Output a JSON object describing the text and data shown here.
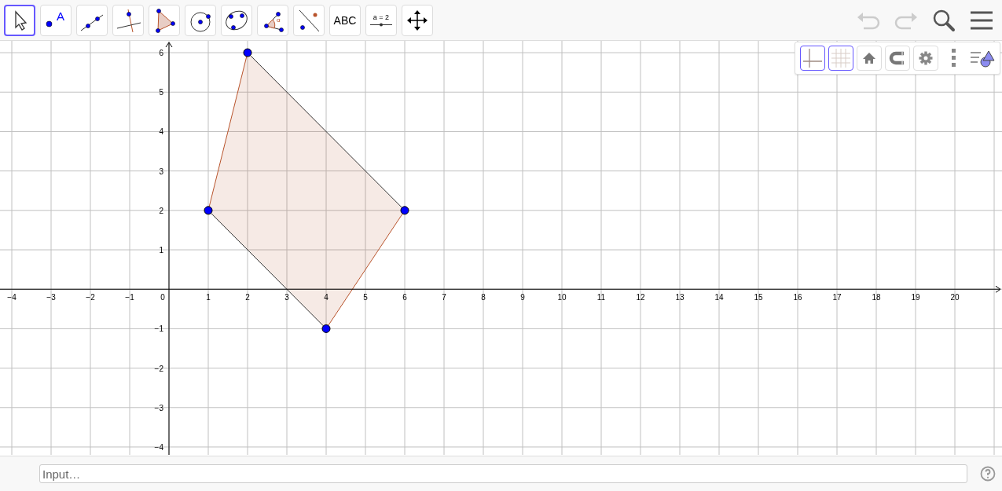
{
  "toolbar": {
    "tools": [
      {
        "kind": "move",
        "selected": true
      },
      {
        "kind": "point",
        "label": "A",
        "selected": false
      },
      {
        "kind": "line",
        "selected": false
      },
      {
        "kind": "perpendicular",
        "selected": false
      },
      {
        "kind": "polygon",
        "selected": false
      },
      {
        "kind": "circle",
        "selected": false
      },
      {
        "kind": "conic",
        "selected": false
      },
      {
        "kind": "angle",
        "label": "α",
        "selected": false
      },
      {
        "kind": "reflect",
        "selected": false
      },
      {
        "kind": "text",
        "label": "ABC",
        "selected": false
      },
      {
        "kind": "slider",
        "label": "a = 2",
        "selected": false
      },
      {
        "kind": "pan",
        "selected": false
      }
    ],
    "actions": [
      {
        "kind": "undo",
        "disabled": true
      },
      {
        "kind": "redo",
        "disabled": true
      },
      {
        "kind": "search",
        "disabled": false
      },
      {
        "kind": "menu",
        "disabled": false
      }
    ]
  },
  "style_bar": [
    {
      "kind": "axes",
      "selected": true
    },
    {
      "kind": "grid",
      "selected": true
    },
    {
      "kind": "home",
      "selected": false
    },
    {
      "kind": "magnet",
      "selected": false
    },
    {
      "kind": "settings",
      "selected": false
    },
    {
      "kind": "more"
    },
    {
      "kind": "view"
    }
  ],
  "graphics": {
    "origin_label": "0",
    "chart_data": {
      "type": "scatter",
      "grid": true,
      "xlim": [
        -4.3,
        21.2
      ],
      "ylim": [
        -4.2,
        6.3
      ],
      "x": [
        1,
        2,
        6,
        4
      ],
      "series": [
        {
          "color": "#0000ff",
          "values": [
            2,
            6,
            2,
            -1
          ]
        }
      ],
      "xticks": [
        {
          "value": -4,
          "label": "−4"
        },
        {
          "value": -3,
          "label": "−3"
        },
        {
          "value": -2,
          "label": "−2"
        },
        {
          "value": -1,
          "label": "−1"
        },
        {
          "value": 1,
          "label": "1"
        },
        {
          "value": 2,
          "label": "2"
        },
        {
          "value": 3,
          "label": "3"
        },
        {
          "value": 4,
          "label": "4"
        },
        {
          "value": 5,
          "label": "5"
        },
        {
          "value": 6,
          "label": "6"
        },
        {
          "value": 7,
          "label": "7"
        },
        {
          "value": 8,
          "label": "8"
        },
        {
          "value": 9,
          "label": "9"
        },
        {
          "value": 10,
          "label": "10"
        },
        {
          "value": 11,
          "label": "11"
        },
        {
          "value": 12,
          "label": "12"
        },
        {
          "value": 13,
          "label": "13"
        },
        {
          "value": 14,
          "label": "14"
        },
        {
          "value": 15,
          "label": "15"
        },
        {
          "value": 16,
          "label": "16"
        },
        {
          "value": 17,
          "label": "17"
        },
        {
          "value": 18,
          "label": "18"
        },
        {
          "value": 19,
          "label": "19"
        },
        {
          "value": 20,
          "label": "20"
        }
      ],
      "yticks": [
        {
          "value": -4,
          "label": "−4"
        },
        {
          "value": -3,
          "label": "−3"
        },
        {
          "value": -2,
          "label": "−2"
        },
        {
          "value": -1,
          "label": "−1"
        },
        {
          "value": 1,
          "label": "1"
        },
        {
          "value": 2,
          "label": "2"
        },
        {
          "value": 3,
          "label": "3"
        },
        {
          "value": 4,
          "label": "4"
        },
        {
          "value": 5,
          "label": "5"
        },
        {
          "value": 6,
          "label": "6"
        }
      ]
    }
  },
  "input_bar": {
    "placeholder": "Input…"
  }
}
